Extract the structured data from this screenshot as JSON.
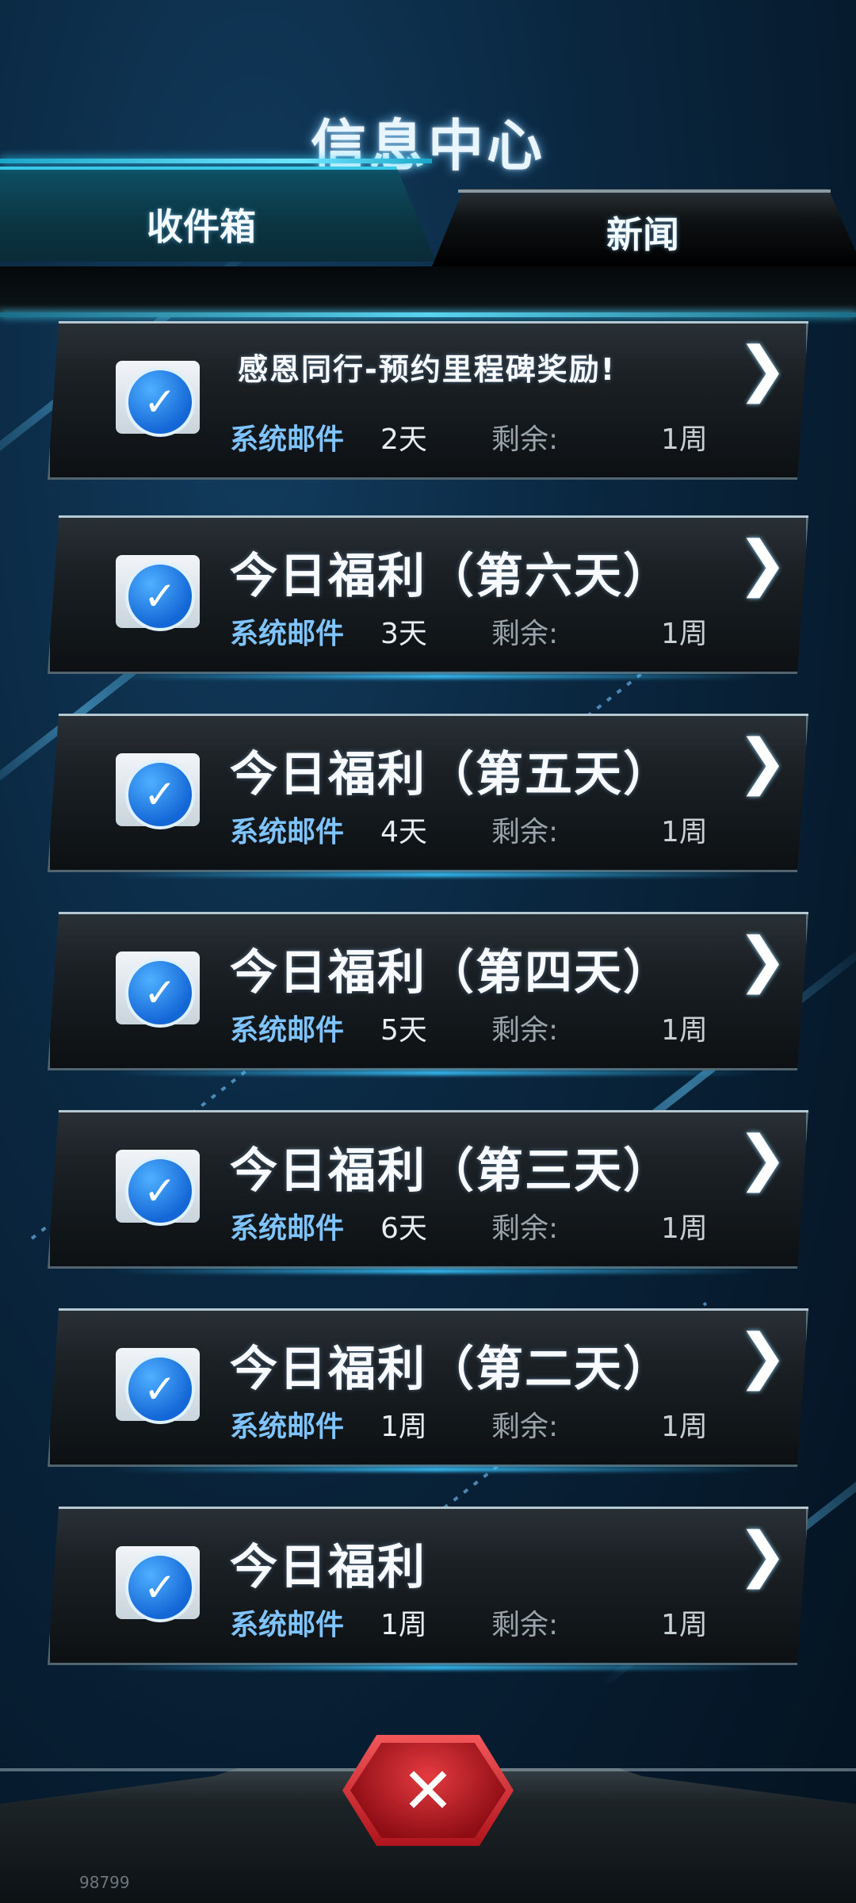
{
  "header": {
    "title": "信息中心"
  },
  "tabs": [
    {
      "label": "收件箱",
      "active": true
    },
    {
      "label": "新闻",
      "active": false
    }
  ],
  "mails": [
    {
      "title": "感恩同行-预约里程碑奖励!",
      "sender": "系统邮件",
      "age": "2天",
      "remain_label": "剩余:",
      "remain": "1周"
    },
    {
      "title": "今日福利（第六天）",
      "sender": "系统邮件",
      "age": "3天",
      "remain_label": "剩余:",
      "remain": "1周"
    },
    {
      "title": "今日福利（第五天）",
      "sender": "系统邮件",
      "age": "4天",
      "remain_label": "剩余:",
      "remain": "1周"
    },
    {
      "title": "今日福利（第四天）",
      "sender": "系统邮件",
      "age": "5天",
      "remain_label": "剩余:",
      "remain": "1周"
    },
    {
      "title": "今日福利（第三天）",
      "sender": "系统邮件",
      "age": "6天",
      "remain_label": "剩余:",
      "remain": "1周"
    },
    {
      "title": "今日福利（第二天）",
      "sender": "系统邮件",
      "age": "1周",
      "remain_label": "剩余:",
      "remain": "1周"
    },
    {
      "title": "今日福利",
      "sender": "系统邮件",
      "age": "1周",
      "remain_label": "剩余:",
      "remain": "1周"
    }
  ],
  "icons": {
    "mail": "checked-mail-icon",
    "open": "chevron-right-icon",
    "close": "close-icon"
  },
  "footer": {
    "id_text": "98799"
  },
  "colors": {
    "accent": "#39c7e6",
    "sender": "#7fc3ff",
    "close": "#c8202a"
  }
}
